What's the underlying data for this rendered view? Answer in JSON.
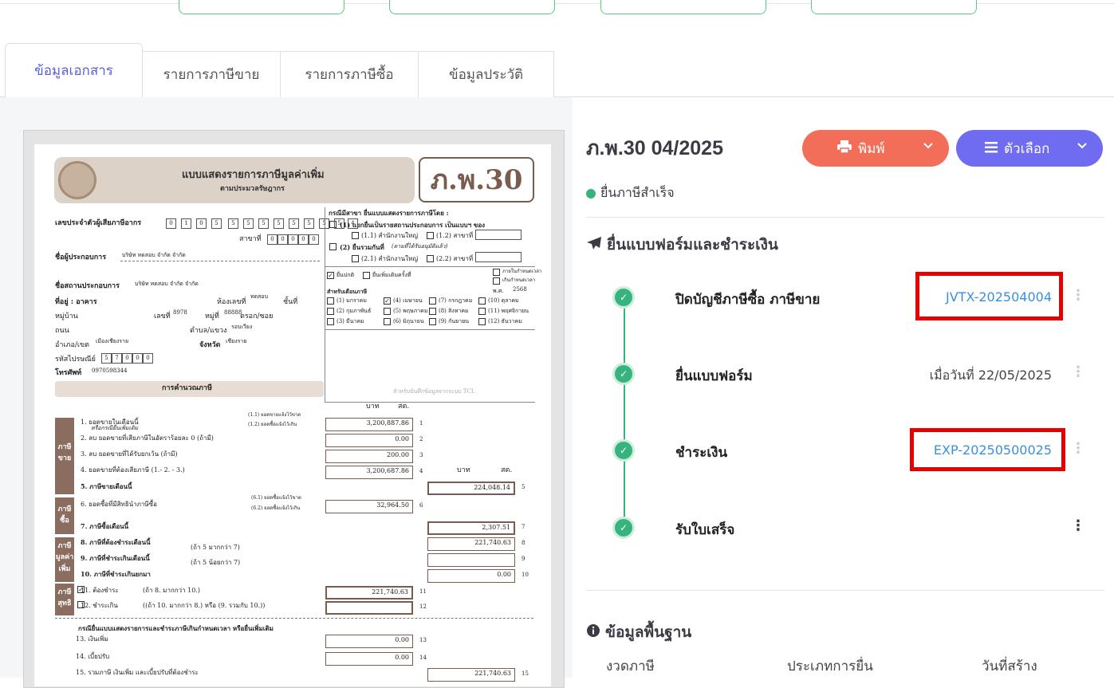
{
  "tabs": [
    "ข้อมูลเอกสาร",
    "รายการภาษีขาย",
    "รายการภาษีซื้อ",
    "ข้อมูลประวัติ"
  ],
  "doc": {
    "title": "ภ.พ.30 04/2025",
    "print_label": "พิมพ์",
    "options_label": "ตัวเลือก",
    "status": "ยื่นภาษีสำเร็จ",
    "status_color": "#36b37e"
  },
  "workflow": {
    "heading": "ยื่นแบบฟอร์มและชำระเงิน",
    "steps": [
      {
        "name": "ปิดบัญชีภาษีซื้อ ภาษีขาย",
        "value": "JVTX-202504004"
      },
      {
        "name": "ยื่นแบบฟอร์ม",
        "value": "เมื่อวันที่ 22/05/2025"
      },
      {
        "name": "ชำระเงิน",
        "value": "EXP-20250500025"
      },
      {
        "name": "รับใบเสร็จ",
        "value": ""
      }
    ]
  },
  "basic": {
    "heading": "ข้อมูลพื้นฐาน",
    "columns": [
      "งวดภาษี",
      "ประเภทการยื่น",
      "วันที่สร้าง"
    ]
  },
  "form": {
    "badge": "ภ.พ.30",
    "header_title": "แบบแสดงรายการภาษีมูลค่าเพิ่ม",
    "header_sub": "ตามประมวลรัษฎากร",
    "taxid_label": "เลขประจำตัวผู้เสียภาษีอากร",
    "taxid_digits": [
      "0",
      "1",
      "0",
      "5",
      "5",
      "5",
      "5",
      "5",
      "5",
      "5",
      "5",
      "5",
      "4"
    ],
    "branch_label": "สาขาที่",
    "branch_digits": [
      "0",
      "0",
      "0",
      "0",
      "0"
    ],
    "operator_label": "ชื่อผู้ประกอบการ",
    "operator_value": "บริษัท ทดสอบ จำกัด จำกัด",
    "place_label": "ชื่อสถานประกอบการ",
    "place_value": "บริษัท ทดสอบ จำกัด จำกัด",
    "address_label": "ที่อยู่ : อาคาร",
    "room_label": "ห้องเลขที่",
    "room_value": "ทดสอบ",
    "floor_label": "ชั้นที่",
    "village_label": "หมู่บ้าน",
    "no_label": "เลขที่",
    "no_value": "8978",
    "moo_label": "หมู่ที่",
    "moo_value": "88888",
    "soi_label": "ตรอก/ซอย",
    "road_label": "ถนน",
    "subdistrict_label": "ตำบล/แขวง",
    "subdistrict_value": "รอบเวียง",
    "district_label": "อำเภอ/เขต",
    "district_value": "เมืองเชียงราย",
    "province_label": "จังหวัด",
    "province_value": "เชียงราย",
    "postal_label": "รหัสไปรษณีย์",
    "postal_digits": [
      "5",
      "7",
      "0",
      "0",
      "0"
    ],
    "phone_label": "โทรศัพท์",
    "phone_value": "0970598344",
    "calc_label": "การคำนวณภาษี",
    "branch_case_title": "กรณีมีสาขา ยื่นแบบแสดงรายการภาษีโดย :",
    "case1": "(1) แยกยื่นเป็นรายสถานประกอบการ  เป็นแบบฯ ของ",
    "case1_1": "(1.1) สำนักงานใหญ่",
    "case1_2": "(1.2) สาขาที่",
    "case2": "(2) ยื่นรวมกันที่",
    "case2_note": "(ตามที่ได้รับอนุมัติแล้ว)",
    "case2_1": "(2.1) สำนักงานใหญ่",
    "case2_2": "(2.2) สาขาที่",
    "normal_label": "ยื่นปกติ",
    "extra_label": "ยื่นเพิ่มเติมครั้งที่",
    "in_time": "ภายในกำหนดเวลา",
    "late": "เกินกำหนดเวลา",
    "month_title": "สำหรับเดือนภาษี",
    "year_label": "พ.ศ.",
    "year_value": "2568",
    "months": [
      "(1) มกราคม",
      "(4) เมษายน",
      "(7) กรกฎาคม",
      "(10) ตุลาคม",
      "(2) กุมภาพันธ์",
      "(5) พฤษภาคม",
      "(8) สิงหาคม",
      "(11) พฤศจิกายน",
      "(3) มีนาคม",
      "(6) มิถุนายน",
      "(9) กันยายน",
      "(12) ธันวาคม"
    ],
    "tcl_note": "สำหรับบันทึกข้อมูลจากระบบ TCL",
    "baht": "บาท",
    "satang": "สต.",
    "side_sale": "ภาษีขาย",
    "side_buy": "ภาษีซื้อ",
    "side_vat": "ภาษีมูลค่าเพิ่ม",
    "side_net": "ภาษีสุทธิ",
    "lines": [
      {
        "label": "1. ยอดขายในเดือนนี้",
        "value": "3,200,887.86",
        "no": "1"
      },
      {
        "label": "2. ลบ ยอดขายที่เสียภาษีในอัตราร้อยละ 0 (ถ้ามี)",
        "value": "0.00",
        "no": "2"
      },
      {
        "label": "3. ลบ ยอดขายที่ได้รับยกเว้น (ถ้ามี)",
        "value": "200.00",
        "no": "3"
      },
      {
        "label": "4. ยอดขายที่ต้องเสียภาษี (1.- 2. - 3.)",
        "value": "3,200,687.86",
        "no": "4"
      },
      {
        "label": "5. ภาษีขายเดือนนี้",
        "value": "224,048.14",
        "no": "5"
      },
      {
        "label": "6. ยอดซื้อที่มีสิทธินำภาษีซื้อ",
        "value": "32,964.50",
        "no": "6"
      },
      {
        "label": "7. ภาษีซื้อเดือนนี้",
        "value": "2,307.51",
        "no": "7"
      },
      {
        "label": "8. ภาษีที่ต้องชำระเดือนนี้",
        "value": "221,740.63",
        "no": "8"
      },
      {
        "label": "9. ภาษีที่ชำระเกินเดือนนี้",
        "value": "",
        "no": "9"
      },
      {
        "label": "10. ภาษีที่ชำระเกินยกมา",
        "value": "0.00",
        "no": "10"
      },
      {
        "label": "11. ต้องชำระ",
        "value": "221,740.63",
        "no": "11"
      },
      {
        "label": "12. ชำระเกิน",
        "value": "",
        "no": "12"
      },
      {
        "label": "13. เงินเพิ่ม",
        "value": "0.00",
        "no": "13"
      },
      {
        "label": "14. เบี้ยปรับ",
        "value": "0.00",
        "no": "14"
      },
      {
        "label": "15. รวมภาษี เงินเพิ่ม และเบี้ยปรับที่ต้องชำระ",
        "value": "221,740.63",
        "no": "15"
      }
    ],
    "sub_1_1": "(1.1) ยอดขายแจ้งไว้ขาด",
    "sub_1_2": "(1.2) ยอดซื้อแจ้งไว้เกิน",
    "sub_6_1": "(6.1) ยอดซื้อแจ้งไว้ขาด",
    "sub_6_2": "(6.2) ยอดซื้อแจ้งไว้เกิน",
    "extra_case": "หรือกรณียื่นเพิ่มเติม",
    "cond_8": "(ถ้า 5 มากกว่า 7)",
    "cond_9": "(ถ้า 5 น้อยกว่า 7)",
    "cond_11": "(ถ้า 8. มากกว่า 10.)",
    "cond_12": "((ถ้า 10. มากกว่า 8.) หรือ (9. รวมกับ 10.))",
    "late_title": "กรณียื่นแบบแสดงรายการและชำระภาษีเกินกำหนดเวลา หรือยื่นเพิ่มเติม"
  }
}
